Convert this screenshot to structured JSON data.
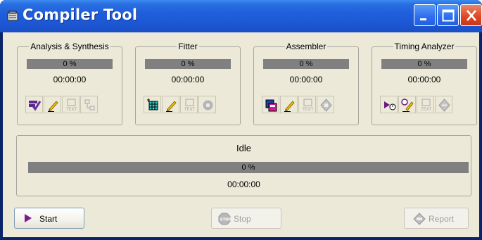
{
  "window": {
    "title": "Compiler Tool",
    "controls": [
      "minimize-icon",
      "maximize-icon",
      "close-icon"
    ]
  },
  "stages": [
    {
      "name": "Analysis & Synthesis",
      "progress_label": "0 %",
      "progress": 0,
      "time": "00:00:00",
      "buttons": [
        {
          "icon": "start-analysis-icon",
          "enabled": true
        },
        {
          "icon": "edit-settings-icon",
          "enabled": true
        },
        {
          "icon": "text-report-icon",
          "enabled": false
        },
        {
          "icon": "netlist-viewer-icon",
          "enabled": false
        }
      ]
    },
    {
      "name": "Fitter",
      "progress_label": "0 %",
      "progress": 0,
      "time": "00:00:00",
      "buttons": [
        {
          "icon": "start-fitter-icon",
          "enabled": true
        },
        {
          "icon": "edit-settings-icon",
          "enabled": true
        },
        {
          "icon": "text-report-icon",
          "enabled": false
        },
        {
          "icon": "chip-planner-icon",
          "enabled": false
        }
      ]
    },
    {
      "name": "Assembler",
      "progress_label": "0 %",
      "progress": 0,
      "time": "00:00:00",
      "buttons": [
        {
          "icon": "start-assembler-icon",
          "enabled": true
        },
        {
          "icon": "edit-settings-icon",
          "enabled": true
        },
        {
          "icon": "text-report-icon",
          "enabled": false
        },
        {
          "icon": "programmer-icon",
          "enabled": false
        }
      ]
    },
    {
      "name": "Timing Analyzer",
      "progress_label": "0 %",
      "progress": 0,
      "time": "00:00:00",
      "buttons": [
        {
          "icon": "start-timing-icon",
          "enabled": true
        },
        {
          "icon": "timing-settings-icon",
          "enabled": true
        },
        {
          "icon": "text-report-icon",
          "enabled": false
        },
        {
          "icon": "report-viewer-icon",
          "enabled": false
        }
      ]
    }
  ],
  "overall": {
    "status": "Idle",
    "progress_label": "0 %",
    "progress": 0,
    "time": "00:00:00"
  },
  "actions": {
    "start": {
      "label": "Start",
      "icon": "play-icon",
      "enabled": true
    },
    "stop": {
      "label": "Stop",
      "icon": "stop-sign-icon",
      "enabled": false
    },
    "report": {
      "label": "Report",
      "icon": "report-icon",
      "enabled": false
    }
  },
  "colors": {
    "title_bar": "#1f5fdc",
    "client_bg": "#ece9d8",
    "progress_track": "#808080",
    "start_arrow": "#7b1a8c"
  }
}
